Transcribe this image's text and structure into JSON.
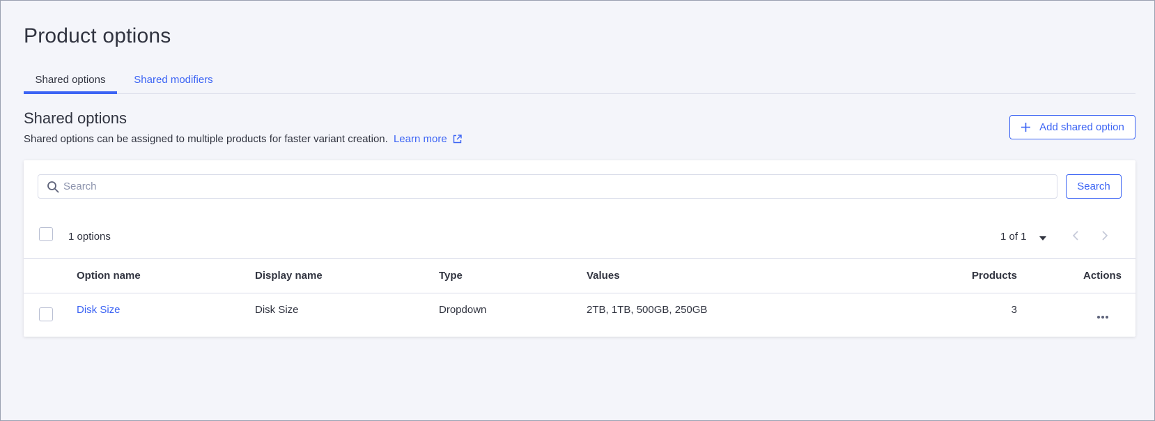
{
  "page": {
    "title": "Product options"
  },
  "tabs": [
    {
      "label": "Shared options",
      "active": true
    },
    {
      "label": "Shared modifiers",
      "active": false
    }
  ],
  "section": {
    "title": "Shared options",
    "description": "Shared options can be assigned to multiple products for faster variant creation.",
    "learn_more": "Learn more",
    "learn_more_icon": "external-link-icon"
  },
  "add_button": {
    "label": "Add shared option",
    "icon": "plus-icon"
  },
  "search": {
    "placeholder": "Search",
    "value": "",
    "button_label": "Search",
    "icon": "search-icon"
  },
  "list": {
    "count_label": "1 options",
    "pager": "1 of 1"
  },
  "table": {
    "columns": [
      "Option name",
      "Display name",
      "Type",
      "Values",
      "Products",
      "Actions"
    ],
    "rows": [
      {
        "option_name": "Disk Size",
        "display_name": "Disk Size",
        "type": "Dropdown",
        "values": "2TB, 1TB, 500GB, 250GB",
        "products": "3",
        "actions_icon": "more-horizontal-icon"
      }
    ]
  },
  "colors": {
    "accent": "#3c64f4",
    "text": "#313440",
    "background": "#f4f5fa",
    "border": "#d9dce9"
  }
}
